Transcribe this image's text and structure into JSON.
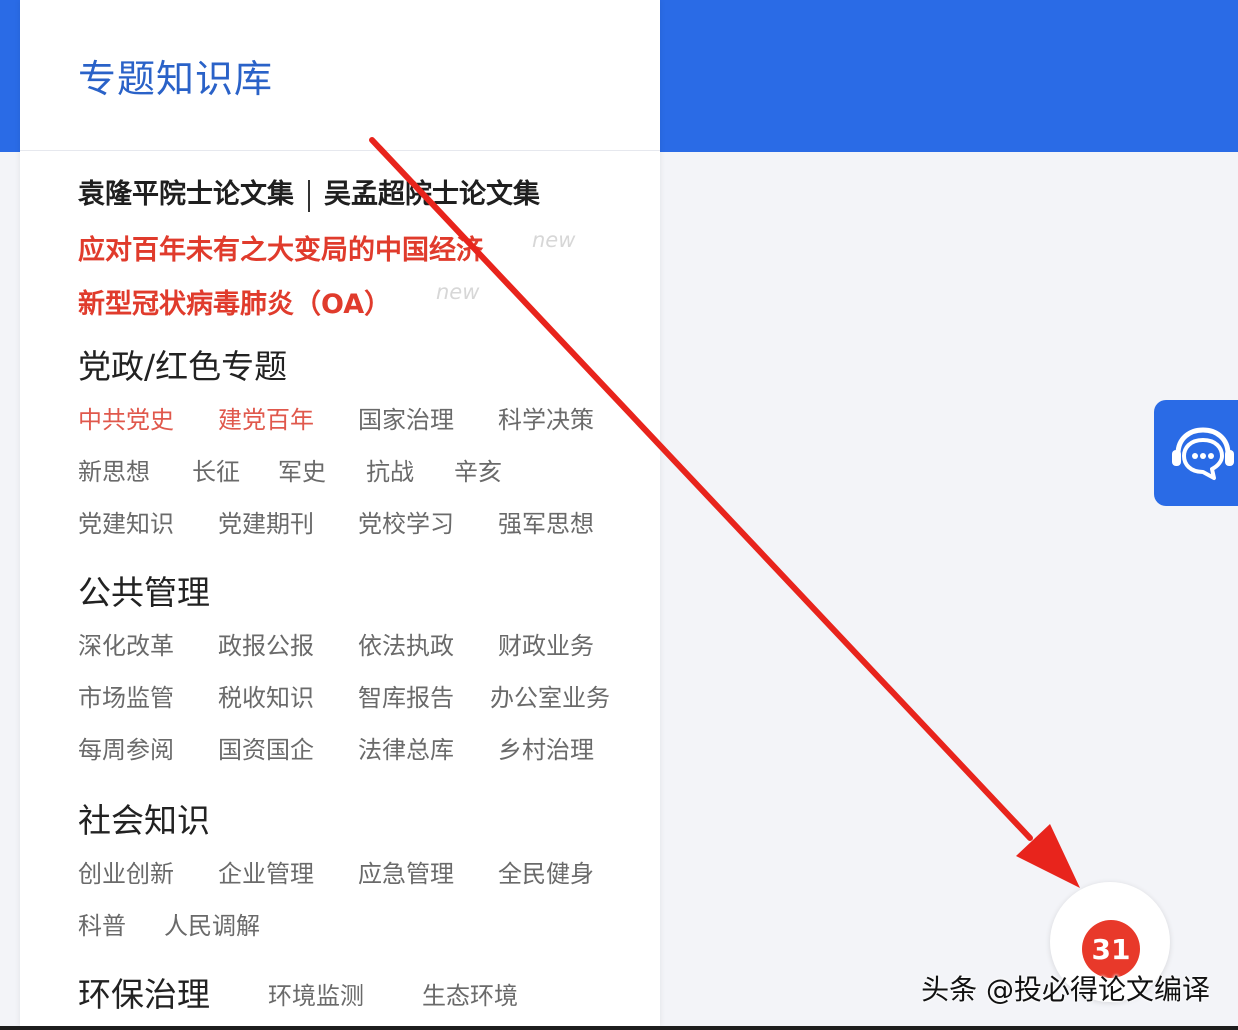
{
  "panel": {
    "title": "专题知识库",
    "special": {
      "item1": "袁隆平院士论文集",
      "item2": "吴孟超院士论文集",
      "red1": "应对百年未有之大变局的中国经济",
      "red1_tag": "new",
      "red2": "新型冠状病毒肺炎（OA）",
      "red2_tag": "new"
    },
    "sections": [
      {
        "title": "党政/红色专题",
        "items": [
          "中共党史",
          "建党百年",
          "国家治理",
          "科学决策",
          "新思想",
          "长征",
          "军史",
          "抗战",
          "辛亥",
          "党建知识",
          "党建期刊",
          "党校学习",
          "强军思想"
        ]
      },
      {
        "title": "公共管理",
        "items": [
          "深化改革",
          "政报公报",
          "依法执政",
          "财政业务",
          "市场监管",
          "税收知识",
          "智库报告",
          "办公室业务",
          "每周参阅",
          "国资国企",
          "法律总库",
          "乡村治理"
        ]
      },
      {
        "title": "社会知识",
        "items": [
          "创业创新",
          "企业管理",
          "应急管理",
          "全民健身",
          "科普",
          "人民调解"
        ]
      },
      {
        "title": "环保治理",
        "items": [
          "环境监测",
          "生态环境"
        ]
      }
    ]
  },
  "badge_count": "31",
  "watermark": "头条 @投必得论文编译",
  "colors": {
    "brand_blue": "#2a6be6",
    "title_blue": "#2a62c8",
    "highlight_red": "#e03b2c",
    "arrow_red": "#e8241c"
  },
  "icons": {
    "chat": "customer-service-chat-icon"
  }
}
